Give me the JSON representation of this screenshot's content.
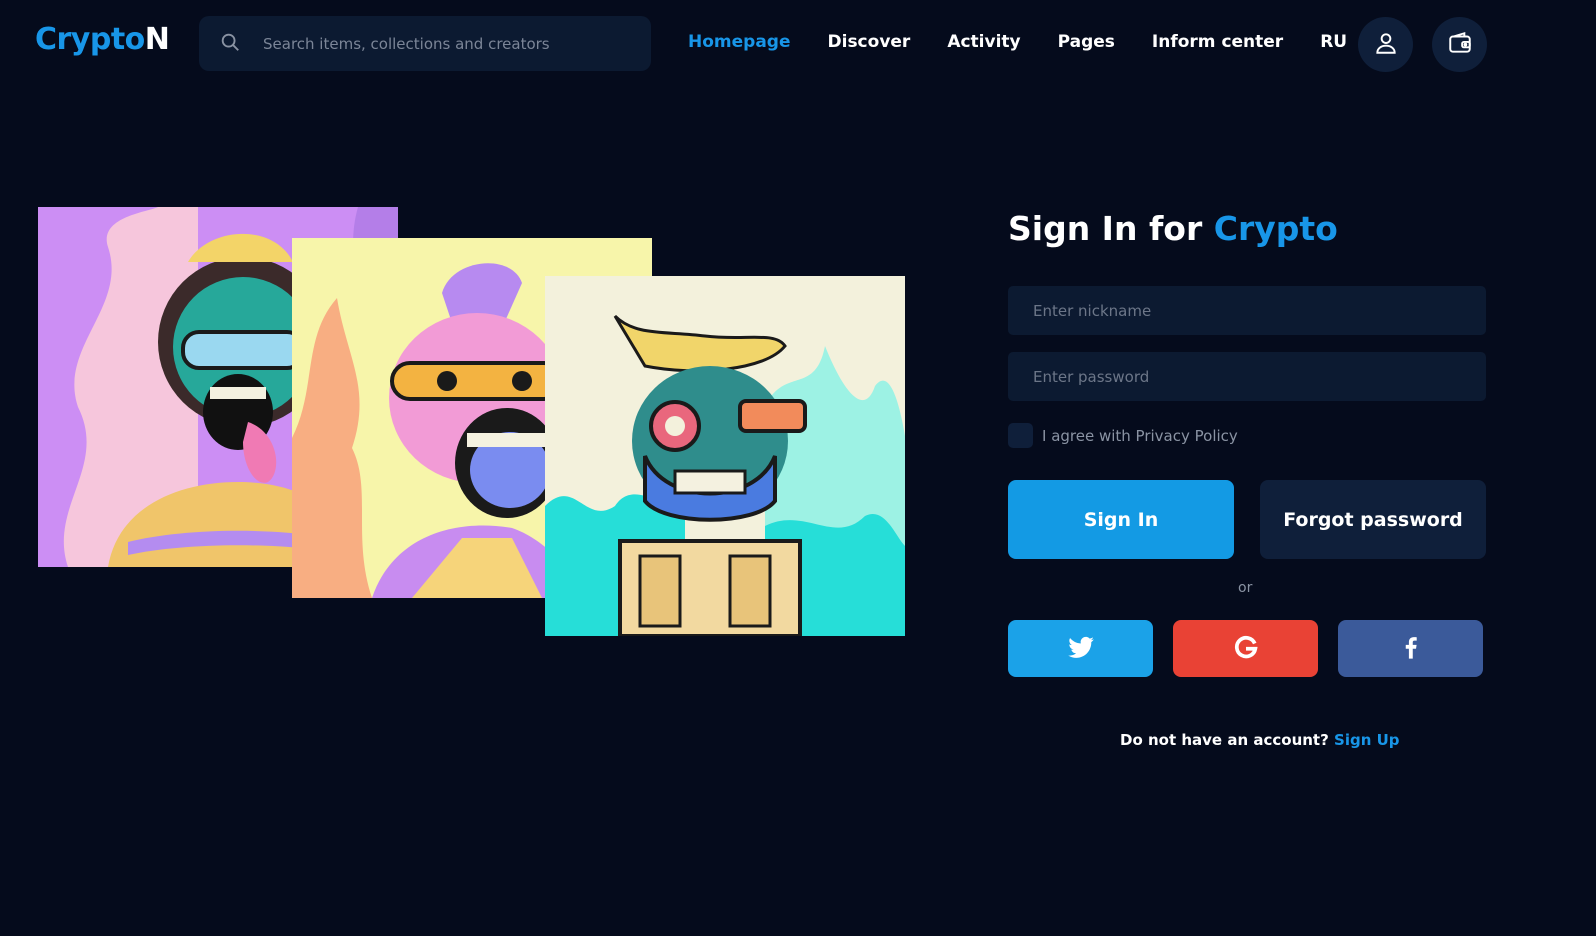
{
  "header": {
    "logo_part1": "Crypto",
    "logo_part2": "N",
    "search_placeholder": "Search items, collections and creators",
    "nav": [
      "Homepage",
      "Discover",
      "Activity",
      "Pages",
      "Inform center",
      "RU"
    ],
    "active_nav": "Homepage",
    "icons": [
      "search-icon",
      "user-icon",
      "wallet-icon"
    ]
  },
  "signin": {
    "title_prefix": "Sign In for ",
    "title_accent": "Crypto",
    "nickname_placeholder": "Enter nickname",
    "password_placeholder": "Enter password",
    "agree_label": "I agree with Privacy Policy",
    "signin_button": "Sign In",
    "forgot_button": "Forgot password",
    "or_text": "or",
    "social": [
      "twitter-icon",
      "google-icon",
      "facebook-icon"
    ],
    "account_prompt": "Do not have an account? ",
    "signup_link": "Sign Up"
  },
  "colors": {
    "background": "#050b1c",
    "accent": "#1896e8",
    "panel": "#0c1a31",
    "twitter": "#1ba2e8",
    "google": "#e94235",
    "facebook": "#3b5a9a"
  },
  "artworks": [
    "skull-art-purple",
    "skull-art-yellow",
    "skull-art-cyan"
  ]
}
